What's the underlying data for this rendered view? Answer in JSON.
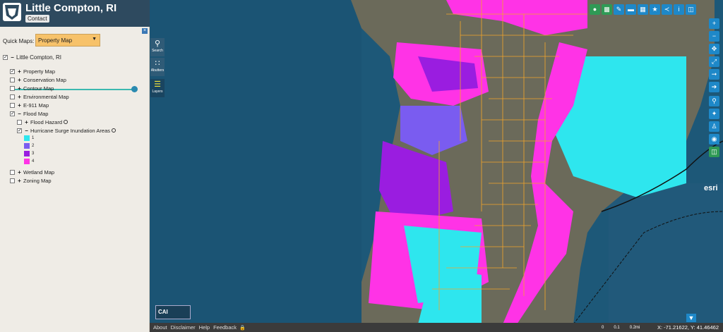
{
  "header": {
    "title": "Little Compton, RI",
    "contact_label": "Contact"
  },
  "quick_maps": {
    "label": "Quick Maps:",
    "selected": "Property Map"
  },
  "layers": {
    "root": "Little Compton, RI",
    "items": [
      {
        "label": "Property Map",
        "checked": true,
        "expand": "+"
      },
      {
        "label": "Conservation Map",
        "checked": false,
        "expand": "+"
      },
      {
        "label": "Contour Map",
        "checked": false,
        "expand": "+"
      },
      {
        "label": "Environmental Map",
        "checked": false,
        "expand": "+"
      },
      {
        "label": "E-911 Map",
        "checked": false,
        "expand": "+"
      },
      {
        "label": "Flood Map",
        "checked": true,
        "expand": "−"
      },
      {
        "label": "Wetland Map",
        "checked": false,
        "expand": "+"
      },
      {
        "label": "Zoning Map",
        "checked": false,
        "expand": "+"
      }
    ],
    "flood_children": [
      {
        "label": "Flood Hazard",
        "checked": false,
        "expand": "+"
      },
      {
        "label": "Hurricane Surge Inundation Areas",
        "checked": true,
        "expand": "−"
      }
    ],
    "legend": [
      {
        "label": "1",
        "color": "#2ee6ee"
      },
      {
        "label": "2",
        "color": "#7a5cf0"
      },
      {
        "label": "3",
        "color": "#9a1de0"
      },
      {
        "label": "4",
        "color": "#ff33e6"
      }
    ]
  },
  "tools": [
    {
      "label": "Search",
      "icon": "search-icon"
    },
    {
      "label": "Abutters",
      "icon": "grid-icon"
    },
    {
      "label": "Layers",
      "icon": "layers-icon"
    }
  ],
  "footer": {
    "links": [
      "About",
      "Disclaimer",
      "Help",
      "Feedback"
    ],
    "scale": [
      "0",
      "0.1",
      "0.2mi"
    ],
    "coords": "X: -71.21622, Y: 41.46462"
  },
  "branding": {
    "cai": "CAI",
    "esri": "esri"
  }
}
